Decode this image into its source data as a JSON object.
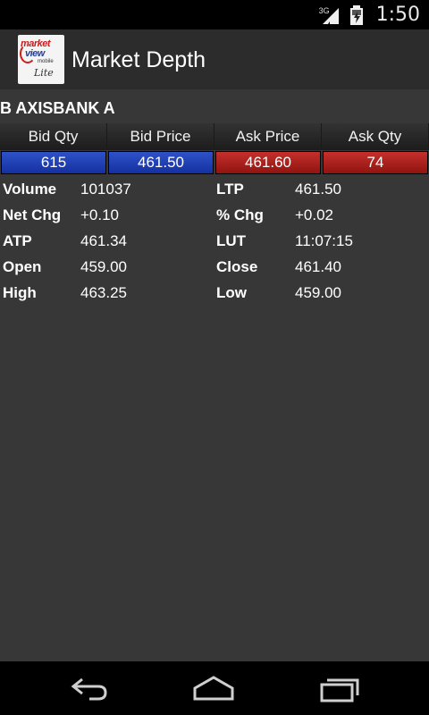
{
  "status_bar": {
    "network": "3G",
    "time": "1:50"
  },
  "action_bar": {
    "logo": {
      "line1": "market",
      "line2": "view",
      "line3": "mobile",
      "line4": "Lite"
    },
    "title": "Market Depth"
  },
  "symbol": "B AXISBANK A",
  "depth": {
    "headers": [
      "Bid Qty",
      "Bid Price",
      "Ask Price",
      "Ask Qty"
    ],
    "values": [
      "615",
      "461.50",
      "461.60",
      "74"
    ],
    "colors": {
      "bid": "#1f3fb5",
      "ask": "#b02320"
    }
  },
  "stats": [
    {
      "label1": "Volume",
      "value1": "101037",
      "label2": "LTP",
      "value2": "461.50"
    },
    {
      "label1": "Net Chg",
      "value1": "+0.10",
      "label2": "% Chg",
      "value2": "+0.02"
    },
    {
      "label1": "ATP",
      "value1": "461.34",
      "label2": "LUT",
      "value2": "11:07:15"
    },
    {
      "label1": "Open",
      "value1": "459.00",
      "label2": "Close",
      "value2": "461.40"
    },
    {
      "label1": "High",
      "value1": "463.25",
      "label2": "Low",
      "value2": "459.00"
    }
  ],
  "nav": {
    "back_icon": "back-arrow-icon",
    "home_icon": "home-icon",
    "recent_icon": "recent-apps-icon"
  }
}
